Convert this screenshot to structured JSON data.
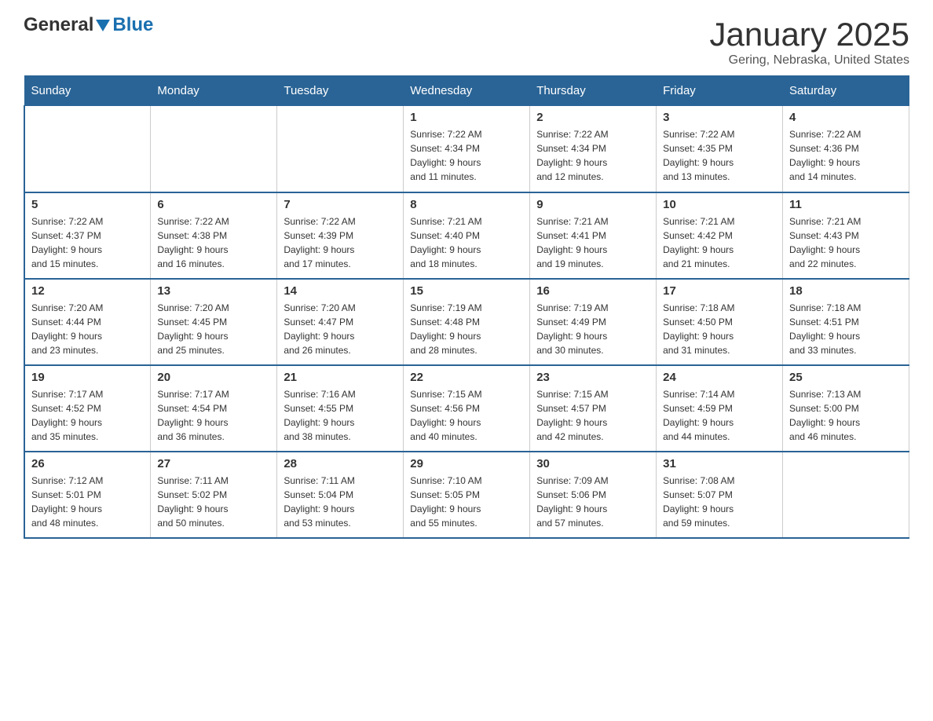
{
  "header": {
    "logo_general": "General",
    "logo_blue": "Blue",
    "title": "January 2025",
    "location": "Gering, Nebraska, United States"
  },
  "days_of_week": [
    "Sunday",
    "Monday",
    "Tuesday",
    "Wednesday",
    "Thursday",
    "Friday",
    "Saturday"
  ],
  "weeks": [
    [
      {
        "day": "",
        "info": ""
      },
      {
        "day": "",
        "info": ""
      },
      {
        "day": "",
        "info": ""
      },
      {
        "day": "1",
        "info": "Sunrise: 7:22 AM\nSunset: 4:34 PM\nDaylight: 9 hours\nand 11 minutes."
      },
      {
        "day": "2",
        "info": "Sunrise: 7:22 AM\nSunset: 4:34 PM\nDaylight: 9 hours\nand 12 minutes."
      },
      {
        "day": "3",
        "info": "Sunrise: 7:22 AM\nSunset: 4:35 PM\nDaylight: 9 hours\nand 13 minutes."
      },
      {
        "day": "4",
        "info": "Sunrise: 7:22 AM\nSunset: 4:36 PM\nDaylight: 9 hours\nand 14 minutes."
      }
    ],
    [
      {
        "day": "5",
        "info": "Sunrise: 7:22 AM\nSunset: 4:37 PM\nDaylight: 9 hours\nand 15 minutes."
      },
      {
        "day": "6",
        "info": "Sunrise: 7:22 AM\nSunset: 4:38 PM\nDaylight: 9 hours\nand 16 minutes."
      },
      {
        "day": "7",
        "info": "Sunrise: 7:22 AM\nSunset: 4:39 PM\nDaylight: 9 hours\nand 17 minutes."
      },
      {
        "day": "8",
        "info": "Sunrise: 7:21 AM\nSunset: 4:40 PM\nDaylight: 9 hours\nand 18 minutes."
      },
      {
        "day": "9",
        "info": "Sunrise: 7:21 AM\nSunset: 4:41 PM\nDaylight: 9 hours\nand 19 minutes."
      },
      {
        "day": "10",
        "info": "Sunrise: 7:21 AM\nSunset: 4:42 PM\nDaylight: 9 hours\nand 21 minutes."
      },
      {
        "day": "11",
        "info": "Sunrise: 7:21 AM\nSunset: 4:43 PM\nDaylight: 9 hours\nand 22 minutes."
      }
    ],
    [
      {
        "day": "12",
        "info": "Sunrise: 7:20 AM\nSunset: 4:44 PM\nDaylight: 9 hours\nand 23 minutes."
      },
      {
        "day": "13",
        "info": "Sunrise: 7:20 AM\nSunset: 4:45 PM\nDaylight: 9 hours\nand 25 minutes."
      },
      {
        "day": "14",
        "info": "Sunrise: 7:20 AM\nSunset: 4:47 PM\nDaylight: 9 hours\nand 26 minutes."
      },
      {
        "day": "15",
        "info": "Sunrise: 7:19 AM\nSunset: 4:48 PM\nDaylight: 9 hours\nand 28 minutes."
      },
      {
        "day": "16",
        "info": "Sunrise: 7:19 AM\nSunset: 4:49 PM\nDaylight: 9 hours\nand 30 minutes."
      },
      {
        "day": "17",
        "info": "Sunrise: 7:18 AM\nSunset: 4:50 PM\nDaylight: 9 hours\nand 31 minutes."
      },
      {
        "day": "18",
        "info": "Sunrise: 7:18 AM\nSunset: 4:51 PM\nDaylight: 9 hours\nand 33 minutes."
      }
    ],
    [
      {
        "day": "19",
        "info": "Sunrise: 7:17 AM\nSunset: 4:52 PM\nDaylight: 9 hours\nand 35 minutes."
      },
      {
        "day": "20",
        "info": "Sunrise: 7:17 AM\nSunset: 4:54 PM\nDaylight: 9 hours\nand 36 minutes."
      },
      {
        "day": "21",
        "info": "Sunrise: 7:16 AM\nSunset: 4:55 PM\nDaylight: 9 hours\nand 38 minutes."
      },
      {
        "day": "22",
        "info": "Sunrise: 7:15 AM\nSunset: 4:56 PM\nDaylight: 9 hours\nand 40 minutes."
      },
      {
        "day": "23",
        "info": "Sunrise: 7:15 AM\nSunset: 4:57 PM\nDaylight: 9 hours\nand 42 minutes."
      },
      {
        "day": "24",
        "info": "Sunrise: 7:14 AM\nSunset: 4:59 PM\nDaylight: 9 hours\nand 44 minutes."
      },
      {
        "day": "25",
        "info": "Sunrise: 7:13 AM\nSunset: 5:00 PM\nDaylight: 9 hours\nand 46 minutes."
      }
    ],
    [
      {
        "day": "26",
        "info": "Sunrise: 7:12 AM\nSunset: 5:01 PM\nDaylight: 9 hours\nand 48 minutes."
      },
      {
        "day": "27",
        "info": "Sunrise: 7:11 AM\nSunset: 5:02 PM\nDaylight: 9 hours\nand 50 minutes."
      },
      {
        "day": "28",
        "info": "Sunrise: 7:11 AM\nSunset: 5:04 PM\nDaylight: 9 hours\nand 53 minutes."
      },
      {
        "day": "29",
        "info": "Sunrise: 7:10 AM\nSunset: 5:05 PM\nDaylight: 9 hours\nand 55 minutes."
      },
      {
        "day": "30",
        "info": "Sunrise: 7:09 AM\nSunset: 5:06 PM\nDaylight: 9 hours\nand 57 minutes."
      },
      {
        "day": "31",
        "info": "Sunrise: 7:08 AM\nSunset: 5:07 PM\nDaylight: 9 hours\nand 59 minutes."
      },
      {
        "day": "",
        "info": ""
      }
    ]
  ]
}
